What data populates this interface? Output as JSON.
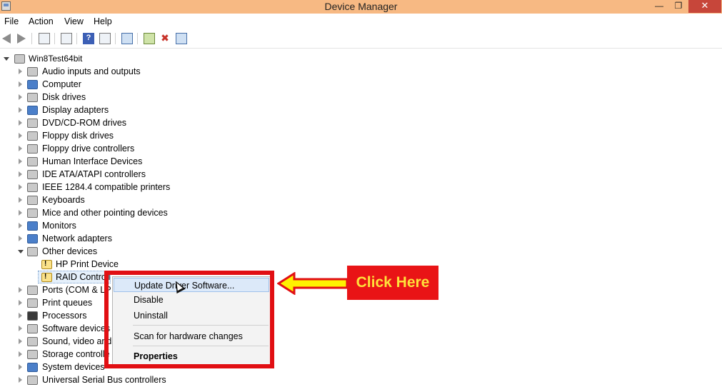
{
  "window": {
    "title": "Device Manager",
    "minimize_glyph": "—",
    "maximize_glyph": "❐",
    "close_glyph": "✕"
  },
  "menu": [
    "File",
    "Action",
    "View",
    "Help"
  ],
  "toolbar": {
    "icons": [
      "back-icon",
      "forward-icon",
      "show-hide-console-tree-icon",
      "properties-icon",
      "help-icon",
      "action-pane-icon",
      "scan-hardware-icon",
      "update-driver-icon",
      "uninstall-icon",
      "enable-device-icon"
    ]
  },
  "tree": {
    "root": "Win8Test64bit",
    "categories": [
      "Audio inputs and outputs",
      "Computer",
      "Disk drives",
      "Display adapters",
      "DVD/CD-ROM drives",
      "Floppy disk drives",
      "Floppy drive controllers",
      "Human Interface Devices",
      "IDE ATA/ATAPI controllers",
      "IEEE 1284.4 compatible printers",
      "Keyboards",
      "Mice and other pointing devices",
      "Monitors",
      "Network adapters",
      "Other devices"
    ],
    "other_devices_children": [
      "HP Print Device",
      "RAID Controll"
    ],
    "categories_after": [
      "Ports (COM & LP",
      "Print queues",
      "Processors",
      "Software devices",
      "Sound, video and",
      "Storage controlle",
      "System devices",
      "Universal Serial Bus controllers"
    ]
  },
  "context_menu": {
    "items": [
      "Update Driver Software...",
      "Disable",
      "Uninstall",
      "Scan for hardware changes",
      "Properties"
    ]
  },
  "annotation": {
    "callout_text": "Click Here",
    "frame_color": "#e10f13",
    "arrow_color": "#fff200"
  }
}
